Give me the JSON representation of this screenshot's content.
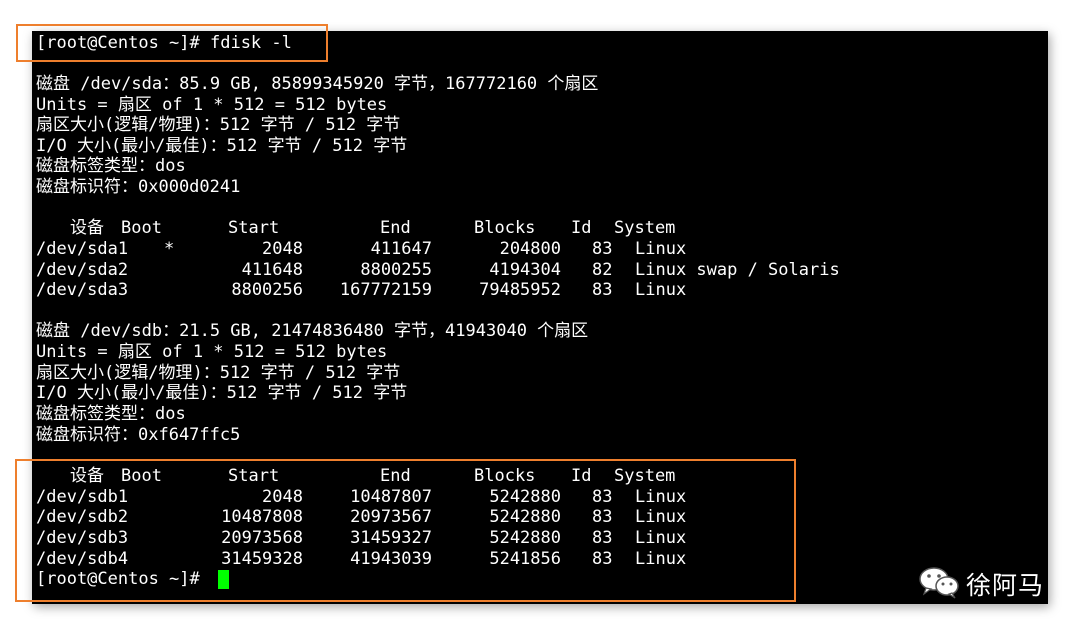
{
  "terminal": {
    "prompt_top": "[root@Centos ~]# fdisk -l",
    "sda": {
      "lines": [
        "磁盘 /dev/sda：85.9 GB, 85899345920 字节，167772160 个扇区",
        "Units = 扇区 of 1 * 512 = 512 bytes",
        "扇区大小(逻辑/物理)：512 字节 / 512 字节",
        "I/O 大小(最小/最佳)：512 字节 / 512 字节",
        "磁盘标签类型：dos",
        "磁盘标识符：0x000d0241"
      ],
      "headers": [
        "设备",
        "Boot",
        "Start",
        "End",
        "Blocks",
        "Id",
        "System"
      ],
      "rows": [
        [
          "/dev/sda1",
          "*",
          "2048",
          "411647",
          "204800",
          "83",
          "Linux"
        ],
        [
          "/dev/sda2",
          "",
          "411648",
          "8800255",
          "4194304",
          "82",
          "Linux swap / Solaris"
        ],
        [
          "/dev/sda3",
          "",
          "8800256",
          "167772159",
          "79485952",
          "83",
          "Linux"
        ]
      ]
    },
    "sdb": {
      "lines": [
        "磁盘 /dev/sdb：21.5 GB, 21474836480 字节，41943040 个扇区",
        "Units = 扇区 of 1 * 512 = 512 bytes",
        "扇区大小(逻辑/物理)：512 字节 / 512 字节",
        "I/O 大小(最小/最佳)：512 字节 / 512 字节",
        "磁盘标签类型：dos",
        "磁盘标识符：0xf647ffc5"
      ],
      "headers": [
        "设备",
        "Boot",
        "Start",
        "End",
        "Blocks",
        "Id",
        "System"
      ],
      "rows": [
        [
          "/dev/sdb1",
          "",
          "2048",
          "10487807",
          "5242880",
          "83",
          "Linux"
        ],
        [
          "/dev/sdb2",
          "",
          "10487808",
          "20973567",
          "5242880",
          "83",
          "Linux"
        ],
        [
          "/dev/sdb3",
          "",
          "20973568",
          "31459327",
          "5242880",
          "83",
          "Linux"
        ],
        [
          "/dev/sdb4",
          "",
          "31459328",
          "41943039",
          "5241856",
          "83",
          "Linux"
        ]
      ]
    },
    "prompt_bottom": "[root@Centos ~]# "
  },
  "watermark": {
    "icon": "wechat-icon",
    "text": "徐阿马"
  },
  "colors": {
    "terminal_bg": "#000000",
    "text": "#ffffff",
    "cursor": "#00ff00",
    "highlight": "#ee7f2d"
  }
}
